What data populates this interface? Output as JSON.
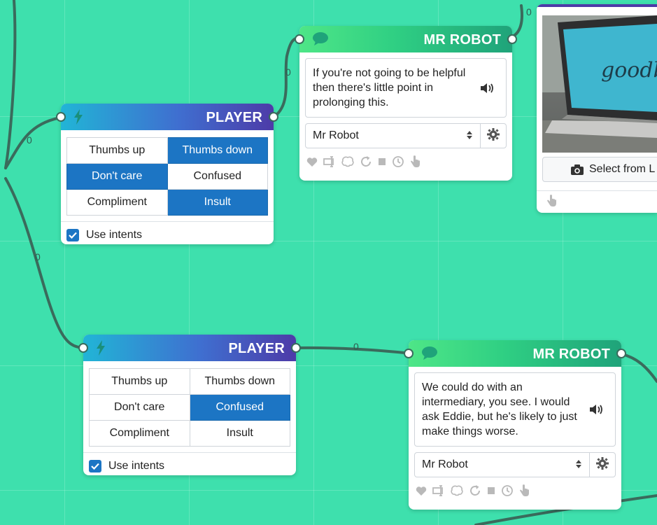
{
  "colors": {
    "canvas": "#3ee0ad",
    "wire": "#3a6b5c",
    "selected": "#1c75c4",
    "icon_gray": "#b9b9b9"
  },
  "wire_labels": [
    "0",
    "0",
    "0",
    "0",
    "0"
  ],
  "player_nodes": [
    {
      "title": "PLAYER",
      "intents": [
        [
          "Thumbs up",
          "Thumbs down"
        ],
        [
          "Don't care",
          "Confused"
        ],
        [
          "Compliment",
          "Insult"
        ]
      ],
      "use_intents_label": "Use intents"
    },
    {
      "title": "PLAYER",
      "intents": [
        [
          "Thumbs up",
          "Thumbs down"
        ],
        [
          "Don't care",
          "Confused"
        ],
        [
          "Compliment",
          "Insult"
        ]
      ],
      "use_intents_label": "Use intents"
    }
  ],
  "robot_nodes": [
    {
      "title": "MR ROBOT",
      "message": "If you're not going to be helpful then there's little point in prolonging this.",
      "character": "Mr Robot"
    },
    {
      "title": "MR ROBOT",
      "message": "We could do with an intermediary, you see. I would ask Eddie, but he's likely to just make things worse.",
      "character": "Mr Robot"
    }
  ],
  "image_node": {
    "button_label": "Select from L",
    "photo_text": "goodb"
  },
  "icons": {
    "player_header": "lightning-icon",
    "robot_header": "speech-bubble-icon",
    "speaker": "speaker-icon",
    "toolbar": [
      "heart-icon",
      "text-cursor-icon",
      "brain-icon",
      "refresh-icon",
      "stop-icon",
      "clock-icon",
      "hand-pointer-icon"
    ]
  }
}
